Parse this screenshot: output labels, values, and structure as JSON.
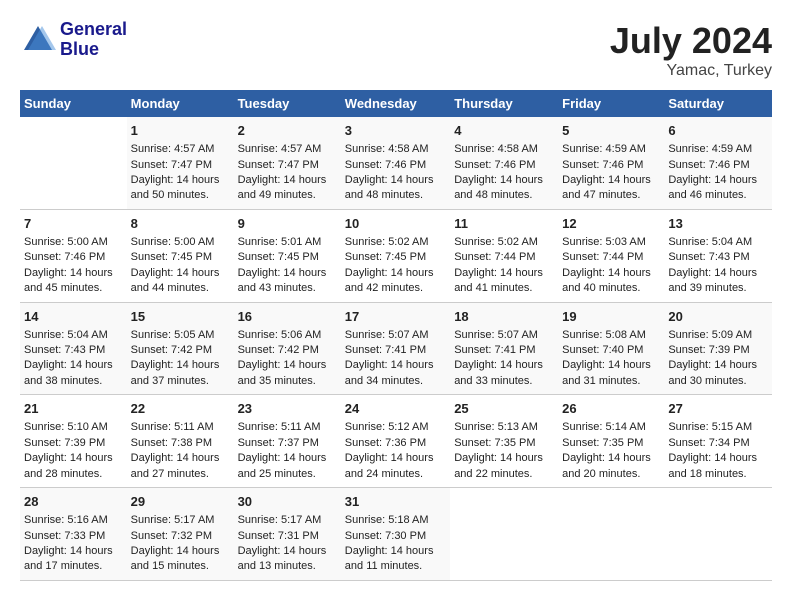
{
  "header": {
    "logo_line1": "General",
    "logo_line2": "Blue",
    "title": "July 2024",
    "subtitle": "Yamac, Turkey"
  },
  "days_of_week": [
    "Sunday",
    "Monday",
    "Tuesday",
    "Wednesday",
    "Thursday",
    "Friday",
    "Saturday"
  ],
  "weeks": [
    [
      {
        "day": "",
        "data": ""
      },
      {
        "day": "1",
        "data": "Sunrise: 4:57 AM\nSunset: 7:47 PM\nDaylight: 14 hours\nand 50 minutes."
      },
      {
        "day": "2",
        "data": "Sunrise: 4:57 AM\nSunset: 7:47 PM\nDaylight: 14 hours\nand 49 minutes."
      },
      {
        "day": "3",
        "data": "Sunrise: 4:58 AM\nSunset: 7:46 PM\nDaylight: 14 hours\nand 48 minutes."
      },
      {
        "day": "4",
        "data": "Sunrise: 4:58 AM\nSunset: 7:46 PM\nDaylight: 14 hours\nand 48 minutes."
      },
      {
        "day": "5",
        "data": "Sunrise: 4:59 AM\nSunset: 7:46 PM\nDaylight: 14 hours\nand 47 minutes."
      },
      {
        "day": "6",
        "data": "Sunrise: 4:59 AM\nSunset: 7:46 PM\nDaylight: 14 hours\nand 46 minutes."
      }
    ],
    [
      {
        "day": "7",
        "data": "Sunrise: 5:00 AM\nSunset: 7:46 PM\nDaylight: 14 hours\nand 45 minutes."
      },
      {
        "day": "8",
        "data": "Sunrise: 5:00 AM\nSunset: 7:45 PM\nDaylight: 14 hours\nand 44 minutes."
      },
      {
        "day": "9",
        "data": "Sunrise: 5:01 AM\nSunset: 7:45 PM\nDaylight: 14 hours\nand 43 minutes."
      },
      {
        "day": "10",
        "data": "Sunrise: 5:02 AM\nSunset: 7:45 PM\nDaylight: 14 hours\nand 42 minutes."
      },
      {
        "day": "11",
        "data": "Sunrise: 5:02 AM\nSunset: 7:44 PM\nDaylight: 14 hours\nand 41 minutes."
      },
      {
        "day": "12",
        "data": "Sunrise: 5:03 AM\nSunset: 7:44 PM\nDaylight: 14 hours\nand 40 minutes."
      },
      {
        "day": "13",
        "data": "Sunrise: 5:04 AM\nSunset: 7:43 PM\nDaylight: 14 hours\nand 39 minutes."
      }
    ],
    [
      {
        "day": "14",
        "data": "Sunrise: 5:04 AM\nSunset: 7:43 PM\nDaylight: 14 hours\nand 38 minutes."
      },
      {
        "day": "15",
        "data": "Sunrise: 5:05 AM\nSunset: 7:42 PM\nDaylight: 14 hours\nand 37 minutes."
      },
      {
        "day": "16",
        "data": "Sunrise: 5:06 AM\nSunset: 7:42 PM\nDaylight: 14 hours\nand 35 minutes."
      },
      {
        "day": "17",
        "data": "Sunrise: 5:07 AM\nSunset: 7:41 PM\nDaylight: 14 hours\nand 34 minutes."
      },
      {
        "day": "18",
        "data": "Sunrise: 5:07 AM\nSunset: 7:41 PM\nDaylight: 14 hours\nand 33 minutes."
      },
      {
        "day": "19",
        "data": "Sunrise: 5:08 AM\nSunset: 7:40 PM\nDaylight: 14 hours\nand 31 minutes."
      },
      {
        "day": "20",
        "data": "Sunrise: 5:09 AM\nSunset: 7:39 PM\nDaylight: 14 hours\nand 30 minutes."
      }
    ],
    [
      {
        "day": "21",
        "data": "Sunrise: 5:10 AM\nSunset: 7:39 PM\nDaylight: 14 hours\nand 28 minutes."
      },
      {
        "day": "22",
        "data": "Sunrise: 5:11 AM\nSunset: 7:38 PM\nDaylight: 14 hours\nand 27 minutes."
      },
      {
        "day": "23",
        "data": "Sunrise: 5:11 AM\nSunset: 7:37 PM\nDaylight: 14 hours\nand 25 minutes."
      },
      {
        "day": "24",
        "data": "Sunrise: 5:12 AM\nSunset: 7:36 PM\nDaylight: 14 hours\nand 24 minutes."
      },
      {
        "day": "25",
        "data": "Sunrise: 5:13 AM\nSunset: 7:35 PM\nDaylight: 14 hours\nand 22 minutes."
      },
      {
        "day": "26",
        "data": "Sunrise: 5:14 AM\nSunset: 7:35 PM\nDaylight: 14 hours\nand 20 minutes."
      },
      {
        "day": "27",
        "data": "Sunrise: 5:15 AM\nSunset: 7:34 PM\nDaylight: 14 hours\nand 18 minutes."
      }
    ],
    [
      {
        "day": "28",
        "data": "Sunrise: 5:16 AM\nSunset: 7:33 PM\nDaylight: 14 hours\nand 17 minutes."
      },
      {
        "day": "29",
        "data": "Sunrise: 5:17 AM\nSunset: 7:32 PM\nDaylight: 14 hours\nand 15 minutes."
      },
      {
        "day": "30",
        "data": "Sunrise: 5:17 AM\nSunset: 7:31 PM\nDaylight: 14 hours\nand 13 minutes."
      },
      {
        "day": "31",
        "data": "Sunrise: 5:18 AM\nSunset: 7:30 PM\nDaylight: 14 hours\nand 11 minutes."
      },
      {
        "day": "",
        "data": ""
      },
      {
        "day": "",
        "data": ""
      },
      {
        "day": "",
        "data": ""
      }
    ]
  ]
}
